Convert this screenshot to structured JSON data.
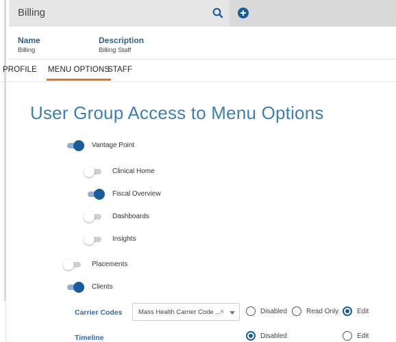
{
  "header": {
    "title": "Billing",
    "icons": {
      "search": "search-icon",
      "add": "plus-circle-icon"
    },
    "accent": "#1a5c99"
  },
  "meta": {
    "name_label": "Name",
    "name_value": "Billing",
    "description_label": "Description",
    "description_value": "Billing Staff"
  },
  "tabs": [
    {
      "label": "PROFILE",
      "active": false
    },
    {
      "label": "MENU OPTIONS",
      "active": true
    },
    {
      "label": "STAFF",
      "active": false
    }
  ],
  "page_title": "User Group Access to Menu Options",
  "menu_options": [
    {
      "label": "Vantage Point",
      "enabled": true,
      "level": 0
    },
    {
      "label": "Clinical Home",
      "enabled": false,
      "level": 1
    },
    {
      "label": "Fiscal Overview",
      "enabled": true,
      "level": 1
    },
    {
      "label": "Dashboards",
      "enabled": false,
      "level": 1
    },
    {
      "label": "Insights",
      "enabled": false,
      "level": 1
    },
    {
      "label": "Placements",
      "enabled": false,
      "level": 0
    },
    {
      "label": "Clients",
      "enabled": true,
      "level": 0
    }
  ],
  "permissions": {
    "carrier_codes": {
      "label": "Carrier Codes",
      "select_value": "Mass Health Carrier Code ...",
      "clear_symbol": "×",
      "options": [
        "Disabled",
        "Read Only",
        "Edit"
      ],
      "selected": "Edit"
    },
    "timeline": {
      "label": "Timeline",
      "options": [
        "Disabled",
        "Edit"
      ],
      "selected": "Disabled"
    }
  }
}
